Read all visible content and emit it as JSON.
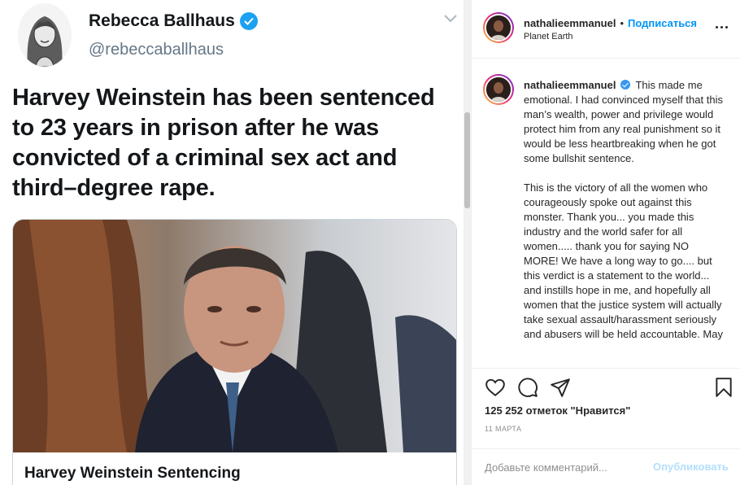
{
  "tweet": {
    "author_name": "Rebecca Ballhaus",
    "author_handle": "@rebeccaballhaus",
    "text": "Harvey Weinstein has been sentenced to 23 years in prison after he was convicted of a criminal sex act and third–degree rape.",
    "card_title": "Harvey Weinstein Sentencing"
  },
  "instagram": {
    "username": "nathalieemmanuel",
    "separator": "•",
    "follow_label": "Подписаться",
    "location": "Planet Earth",
    "caption_paragraphs": [
      "This made me emotional. I had convinced myself that this man’s wealth, power and privilege would protect him from any real punishment so it would be less heartbreaking when he got some bullshit sentence.",
      "This is the victory of all the women who courageously spoke out against this monster. Thank you... you made this industry and the world safer for all women..... thank you for saying NO MORE! We have a long way to go.... but this verdict is a statement to the world... and instills hope in me, and hopefully all women that the justice system will actually take sexual assault/harassment seriously and abusers will be held accountable. May"
    ],
    "likes": "125 252 отметок \"Нравится\"",
    "date": "11 МАРТА",
    "comment_placeholder": "Добавьте комментарий...",
    "publish_label": "Опубликовать",
    "icons": [
      "heart-icon",
      "comment-icon",
      "share-icon",
      "bookmark-icon",
      "more-icon"
    ]
  },
  "colors": {
    "twitter_blue": "#1da1f2",
    "instagram_link": "#0095f6",
    "publish_disabled": "#b2dffc"
  }
}
